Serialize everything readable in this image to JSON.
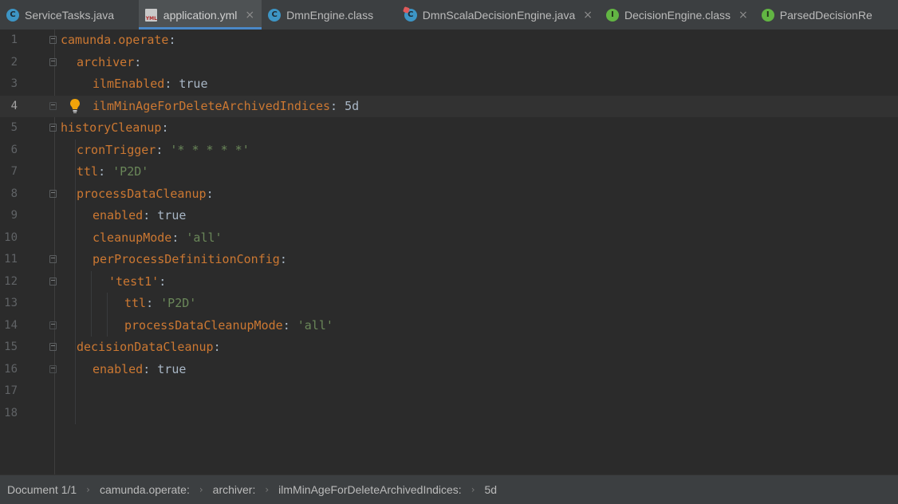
{
  "tabs": [
    {
      "label": "ServiceTasks.java",
      "icon": "class-icon"
    },
    {
      "label": "application.yml",
      "icon": "yml-file-icon",
      "active": true
    },
    {
      "label": "DmnEngine.class",
      "icon": "class-icon"
    },
    {
      "label": "DmnScalaDecisionEngine.java",
      "icon": "class-icon"
    },
    {
      "label": "DecisionEngine.class",
      "icon": "interface-icon"
    },
    {
      "label": "ParsedDecisionRe",
      "icon": "interface-icon"
    }
  ],
  "icon_letters": {
    "class": "C",
    "interface": "I",
    "yml": "YML"
  },
  "close_glyph": "×",
  "editor": {
    "current_line": 4,
    "lines": [
      {
        "n": "1",
        "key": "camunda.operate",
        "colon": ":",
        "value": ""
      },
      {
        "n": "2",
        "key": "archiver",
        "colon": ":",
        "value": ""
      },
      {
        "n": "3",
        "key": "ilmEnabled",
        "colon": ": ",
        "value": "true"
      },
      {
        "n": "4",
        "key": "ilmMinAgeForDeleteArchivedIndices",
        "colon": ": ",
        "value": "5d"
      },
      {
        "n": "5",
        "key": "historyCleanup",
        "colon": ":",
        "value": ""
      },
      {
        "n": "6",
        "key": "cronTrigger",
        "colon": ": ",
        "value": "'* * * * *'"
      },
      {
        "n": "7",
        "key": "ttl",
        "colon": ": ",
        "value": "'P2D'"
      },
      {
        "n": "8",
        "key": "processDataCleanup",
        "colon": ":",
        "value": ""
      },
      {
        "n": "9",
        "key": "enabled",
        "colon": ": ",
        "value": "true"
      },
      {
        "n": "10",
        "key": "cleanupMode",
        "colon": ": ",
        "value": "'all'"
      },
      {
        "n": "11",
        "key": "perProcessDefinitionConfig",
        "colon": ":",
        "value": ""
      },
      {
        "n": "12",
        "key": "'test1'",
        "colon": ":",
        "value": ""
      },
      {
        "n": "13",
        "key": "ttl",
        "colon": ": ",
        "value": "'P2D'"
      },
      {
        "n": "14",
        "key": "processDataCleanupMode",
        "colon": ": ",
        "value": "'all'"
      },
      {
        "n": "15",
        "key": "decisionDataCleanup",
        "colon": ":",
        "value": ""
      },
      {
        "n": "16",
        "key": "enabled",
        "colon": ": ",
        "value": "true"
      },
      {
        "n": "17",
        "key": "",
        "colon": "",
        "value": ""
      },
      {
        "n": "18",
        "key": "",
        "colon": "",
        "value": ""
      }
    ]
  },
  "statusbar": {
    "document": "Document 1/1",
    "separator": "›",
    "breadcrumbs": [
      "camunda.operate:",
      "archiver:",
      "ilmMinAgeForDeleteArchivedIndices:",
      "5d"
    ]
  },
  "colors": {
    "background": "#2b2b2b",
    "key": "#cc7832",
    "string": "#6a8759",
    "text": "#a9b7c6",
    "accent": "#4a88c7"
  }
}
